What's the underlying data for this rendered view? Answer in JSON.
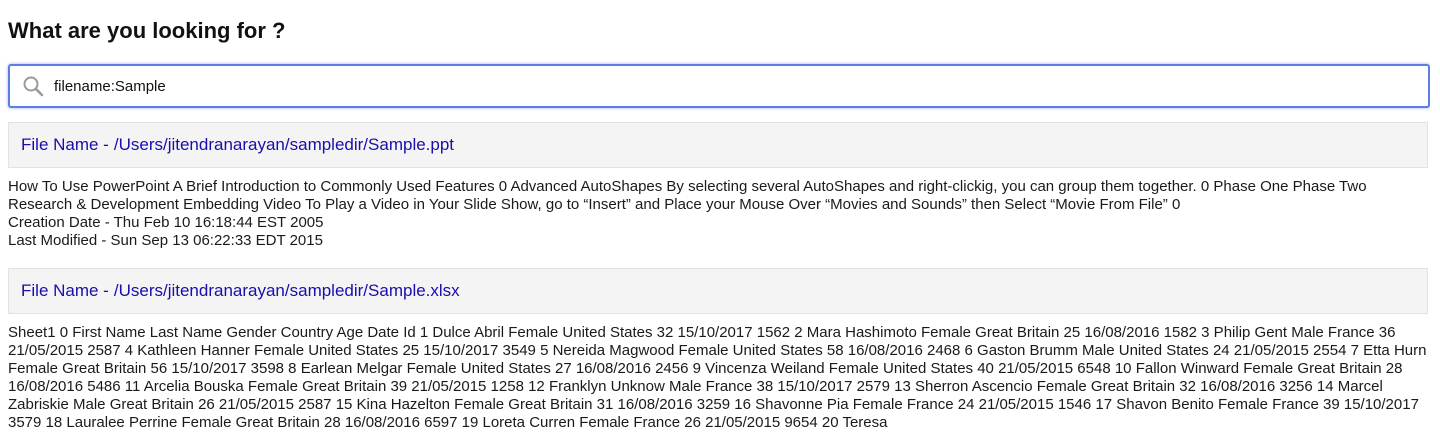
{
  "heading": "What are you looking for ?",
  "search": {
    "value": "filename:Sample",
    "icon": "search-icon"
  },
  "results": [
    {
      "label_prefix": "File Name -",
      "path": "/Users/jitendranarayan/sampledir/Sample.ppt",
      "content": "How To Use PowerPoint A Brief Introduction to Commonly Used Features 0 Advanced AutoShapes By selecting several AutoShapes and right-clickig, you can group them together. 0 Phase One Phase Two Research & Development Embedding Video To Play a Video in Your Slide Show, go to “Insert” and Place your Mouse Over “Movies and Sounds” then Select “Movie From File” 0",
      "created": "Creation Date - Thu Feb 10 16:18:44 EST 2005",
      "modified": "Last Modified - Sun Sep 13 06:22:33 EDT 2015"
    },
    {
      "label_prefix": "File Name -",
      "path": "/Users/jitendranarayan/sampledir/Sample.xlsx",
      "content": "Sheet1 0 First Name Last Name Gender Country Age Date Id 1 Dulce Abril Female United States 32 15/10/2017 1562 2 Mara Hashimoto Female Great Britain 25 16/08/2016 1582 3 Philip Gent Male France 36 21/05/2015 2587 4 Kathleen Hanner Female United States 25 15/10/2017 3549 5 Nereida Magwood Female United States 58 16/08/2016 2468 6 Gaston Brumm Male United States 24 21/05/2015 2554 7 Etta Hurn Female Great Britain 56 15/10/2017 3598 8 Earlean Melgar Female United States 27 16/08/2016 2456 9 Vincenza Weiland Female United States 40 21/05/2015 6548 10 Fallon Winward Female Great Britain 28 16/08/2016 5486 11 Arcelia Bouska Female Great Britain 39 21/05/2015 1258 12 Franklyn Unknow Male France 38 15/10/2017 2579 13 Sherron Ascencio Female Great Britain 32 16/08/2016 3256 14 Marcel Zabriskie Male Great Britain 26 21/05/2015 2587 15 Kina Hazelton Female Great Britain 31 16/08/2016 3259 16 Shavonne Pia Female France 24 21/05/2015 1546 17 Shavon Benito Female France 39 15/10/2017 3579 18 Lauralee Perrine Female Great Britain 28 16/08/2016 6597 19 Loreta Curren Female France 26 21/05/2015 9654 20 Teresa"
    }
  ]
}
